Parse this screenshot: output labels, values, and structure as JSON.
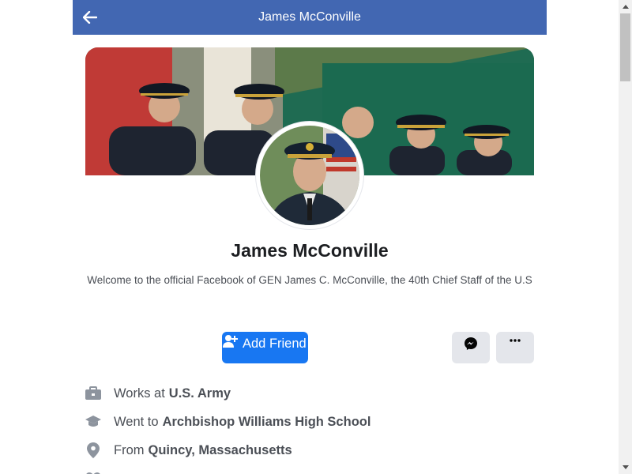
{
  "header": {
    "title": "James McConville",
    "back_icon": "arrow-left-icon"
  },
  "profile": {
    "name": "James McConville",
    "bio": "Welcome to the official Facebook of GEN James C. McConville, the 40th Chief Staff of the U.S"
  },
  "actions": {
    "add_friend_label": "Add Friend",
    "messenger_icon": "messenger-icon",
    "more_icon": "more-dots-icon"
  },
  "about": [
    {
      "icon": "briefcase-icon",
      "prefix": "Works at",
      "value": "U.S. Army"
    },
    {
      "icon": "graduation-cap-icon",
      "prefix": "Went to",
      "value": "Archbishop Williams High School"
    },
    {
      "icon": "location-pin-icon",
      "prefix": "From",
      "value": "Quincy, Massachusetts"
    },
    {
      "icon": "heart-icon",
      "prefix": "",
      "value": ""
    }
  ],
  "colors": {
    "header_bg": "#4267b2",
    "primary": "#1877f2",
    "button_gray": "#e4e6eb",
    "text": "#1c1e21"
  }
}
